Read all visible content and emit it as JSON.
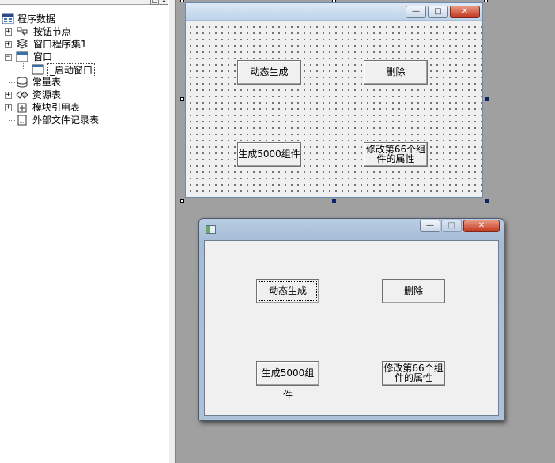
{
  "tree": {
    "root_label": "程序数据",
    "items": [
      {
        "label": "按钮节点",
        "expander": "+"
      },
      {
        "label": "窗口程序集1",
        "expander": "+"
      },
      {
        "label": "窗口",
        "expander": "−"
      },
      {
        "label": "_启动窗口",
        "expander": ""
      },
      {
        "label": "常量表",
        "expander": ""
      },
      {
        "label": "资源表",
        "expander": "+"
      },
      {
        "label": "模块引用表",
        "expander": "+"
      },
      {
        "label": "外部文件记录表",
        "expander": ""
      }
    ],
    "panel_buttons": [
      "□",
      "×"
    ]
  },
  "design_form": {
    "caption_buttons": {
      "minimize": "—",
      "maximize": "□",
      "close": "✕"
    },
    "buttons": {
      "dynamic_generate": "动态生成",
      "delete": "删除",
      "generate_5000": "生成5000组件",
      "modify_66_line1": "修改第66个组",
      "modify_66_line2": "件的属性"
    }
  },
  "preview_window": {
    "caption_buttons": {
      "minimize": "—",
      "maximize": "□",
      "close": "✕"
    },
    "buttons": {
      "dynamic_generate": "动态生成",
      "delete": "删除",
      "generate_5000": "生成5000组件",
      "modify_66_line1": "修改第66个组",
      "modify_66_line2": "件的属性"
    }
  },
  "colors": {
    "desktop": "#a0a0a0",
    "close_button": "#c4351c",
    "titlebar": "#bed3ea"
  }
}
